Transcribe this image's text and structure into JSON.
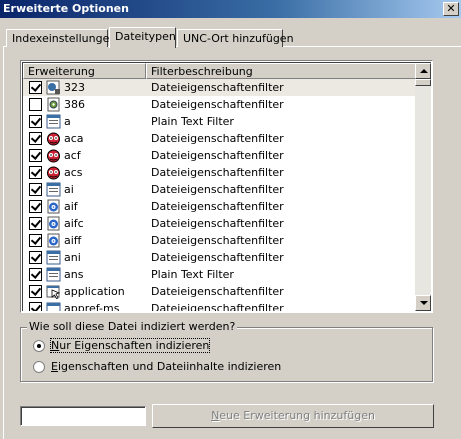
{
  "window": {
    "title": "Erweiterte Optionen",
    "close_glyph": "✕"
  },
  "tabs": [
    {
      "label": "Indexeinstellungen",
      "active": false
    },
    {
      "label": "Dateitypen",
      "active": true
    },
    {
      "label": "UNC-Ort hinzufügen",
      "active": false
    }
  ],
  "list": {
    "columns": [
      "Erweiterung",
      "Filterbeschreibung"
    ],
    "rows": [
      {
        "ext": "323",
        "desc": "Dateieigenschaftenfilter",
        "checked": true,
        "icon": "phone-doc-icon"
      },
      {
        "ext": "386",
        "desc": "Dateieigenschaftenfilter",
        "checked": false,
        "icon": "gear-doc-icon"
      },
      {
        "ext": "a",
        "desc": "Plain Text Filter",
        "checked": true,
        "icon": "system-file-icon"
      },
      {
        "ext": "aca",
        "desc": "Dateieigenschaftenfilter",
        "checked": true,
        "icon": "agent-character-icon"
      },
      {
        "ext": "acf",
        "desc": "Dateieigenschaftenfilter",
        "checked": true,
        "icon": "agent-character-icon"
      },
      {
        "ext": "acs",
        "desc": "Dateieigenschaftenfilter",
        "checked": true,
        "icon": "agent-character-icon"
      },
      {
        "ext": "ai",
        "desc": "Dateieigenschaftenfilter",
        "checked": true,
        "icon": "system-file-icon"
      },
      {
        "ext": "aif",
        "desc": "Dateieigenschaftenfilter",
        "checked": true,
        "icon": "audio-file-icon"
      },
      {
        "ext": "aifc",
        "desc": "Dateieigenschaftenfilter",
        "checked": true,
        "icon": "audio-file-icon"
      },
      {
        "ext": "aiff",
        "desc": "Dateieigenschaftenfilter",
        "checked": true,
        "icon": "audio-file-icon"
      },
      {
        "ext": "ani",
        "desc": "Dateieigenschaftenfilter",
        "checked": true,
        "icon": "system-file-icon"
      },
      {
        "ext": "ans",
        "desc": "Plain Text Filter",
        "checked": true,
        "icon": "system-file-icon"
      },
      {
        "ext": "application",
        "desc": "Dateieigenschaftenfilter",
        "checked": true,
        "icon": "application-file-icon"
      },
      {
        "ext": "appref-ms",
        "desc": "Dateieigenschaftenfilter",
        "checked": true,
        "icon": "blank-window-icon"
      }
    ]
  },
  "index_group": {
    "legend": "Wie soll diese Datei indiziert werden?",
    "option1_mnemonic": "N",
    "option1_rest": "ur Eigenschaften indizieren",
    "option2_mnemonic": "E",
    "option2_rest": "igenschaften und Dateiinhalte indizieren",
    "selected": 1
  },
  "new_extension": {
    "input_value": "",
    "button_mnemonic": "N",
    "button_rest": "eue Erweiterung hinzufügen"
  }
}
